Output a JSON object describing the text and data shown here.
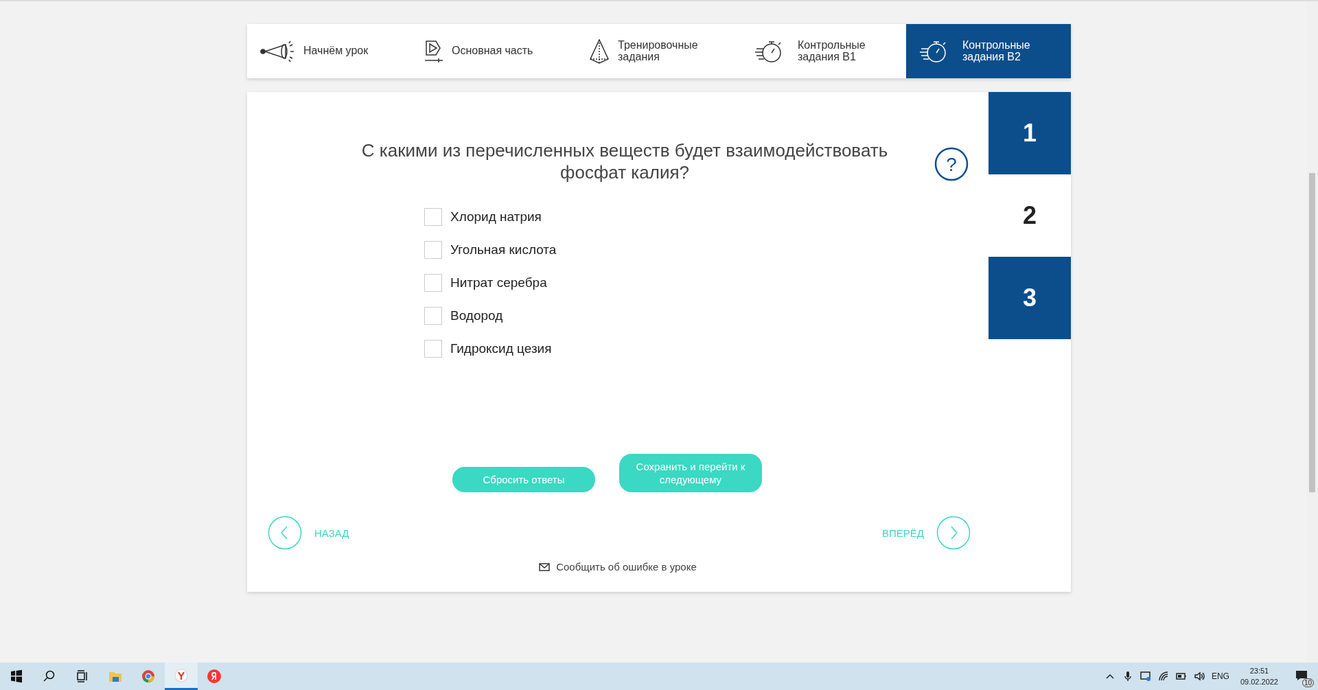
{
  "tabs": [
    {
      "kind": "start",
      "label": "Начнём урок",
      "selected": false
    },
    {
      "kind": "main",
      "label": "Основная часть",
      "selected": false
    },
    {
      "kind": "training",
      "label": "Тренировочные задания",
      "selected": false
    },
    {
      "kind": "control",
      "label": "Контрольные задания В1",
      "selected": false
    },
    {
      "kind": "control",
      "label": "Контрольные задания В2",
      "selected": true
    }
  ],
  "help": "?",
  "question": {
    "text": "С какими из перечисленных веществ будет взаимодействовать фосфат калия?",
    "options": [
      {
        "label": "Хлорид натрия",
        "checked": false
      },
      {
        "label": "Угольная кислота",
        "checked": false
      },
      {
        "label": "Нитрат серебра",
        "checked": false
      },
      {
        "label": "Водород",
        "checked": false
      },
      {
        "label": "Гидроксид цезия",
        "checked": false
      }
    ]
  },
  "question_numbers": [
    {
      "label": "1",
      "selected": false
    },
    {
      "label": "2",
      "selected": true
    },
    {
      "label": "3",
      "selected": false
    }
  ],
  "buttons": [
    "Сбросить ответы",
    "Сохранить и перейти к следующему"
  ],
  "nav": {
    "back": "НАЗАД",
    "forward": "ВПЕРЁД"
  },
  "report_link": "Сообщить об ошибке в уроке",
  "taskbar": {
    "apps": [
      {
        "kind": "start"
      },
      {
        "kind": "search"
      },
      {
        "kind": "taskview"
      },
      {
        "kind": "folder",
        "selected": false
      },
      {
        "kind": "chrome",
        "selected": false
      },
      {
        "kind": "yandex-browser",
        "selected": true
      },
      {
        "kind": "yandex",
        "selected": false
      }
    ],
    "language": "ENG",
    "time": "23:51",
    "date": "09.02.2022",
    "notifications": "10"
  }
}
